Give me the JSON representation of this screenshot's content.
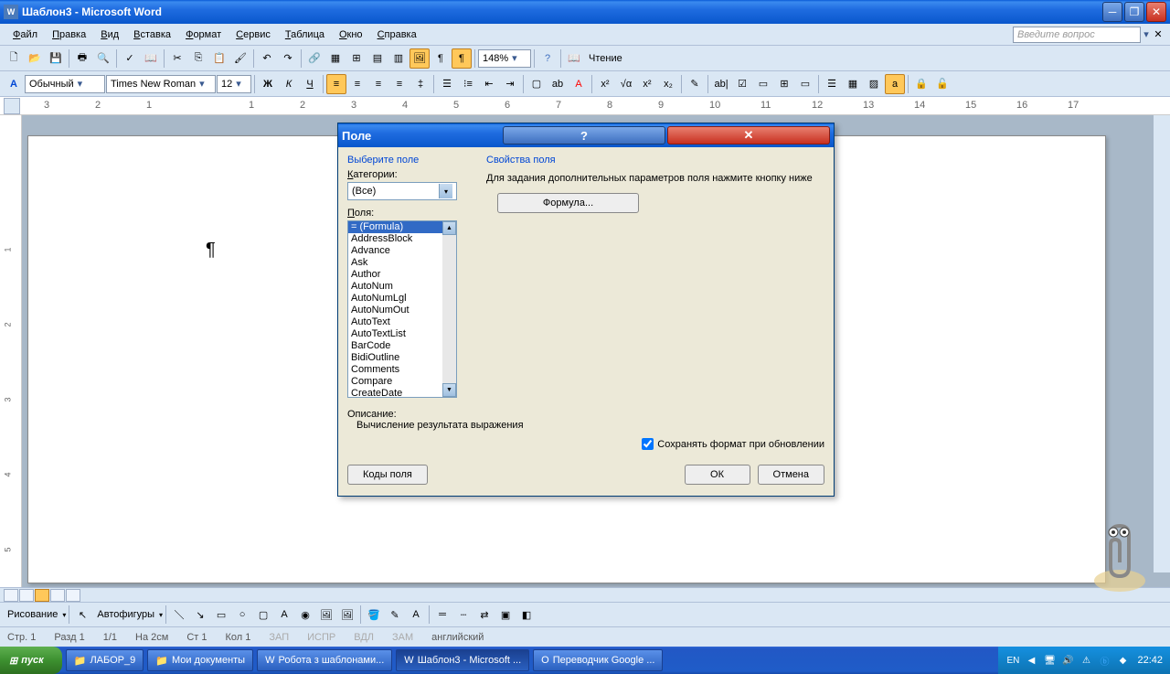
{
  "app": {
    "title": "Шаблон3 - Microsoft Word",
    "icon_letter": "W"
  },
  "menu": {
    "items": [
      "Файл",
      "Правка",
      "Вид",
      "Вставка",
      "Формат",
      "Сервис",
      "Таблица",
      "Окно",
      "Справка"
    ],
    "help_placeholder": "Введите вопрос"
  },
  "toolbar1": {
    "zoom": "148%",
    "reading": "Чтение"
  },
  "format": {
    "style_label": "A",
    "style": "Обычный",
    "font": "Times New Roman",
    "size": "12"
  },
  "ruler": {
    "nums": [
      "3",
      "2",
      "1",
      "",
      "1",
      "2",
      "3",
      "4",
      "5",
      "6",
      "7",
      "8",
      "9",
      "10",
      "11",
      "12",
      "13",
      "14",
      "15",
      "16",
      "17"
    ]
  },
  "vruler": {
    "nums": [
      "",
      "1",
      "2",
      "3",
      "4",
      "5"
    ]
  },
  "drawbar": {
    "draw": "Рисование",
    "autoshapes": "Автофигуры"
  },
  "status": {
    "page": "Стр. 1",
    "sect": "Разд 1",
    "pages": "1/1",
    "at": "На 2см",
    "line": "Ст 1",
    "col": "Кол 1",
    "rec": "ЗАП",
    "trk": "ИСПР",
    "ext": "ВДЛ",
    "ovr": "ЗАМ",
    "lang": "английский"
  },
  "dialog": {
    "title": "Поле",
    "select_field": "Выберите поле",
    "categories_label": "Категории:",
    "category": "(Все)",
    "fields_label": "Поля:",
    "fields": [
      "= (Formula)",
      "AddressBlock",
      "Advance",
      "Ask",
      "Author",
      "AutoNum",
      "AutoNumLgl",
      "AutoNumOut",
      "AutoText",
      "AutoTextList",
      "BarCode",
      "BidiOutline",
      "Comments",
      "Compare",
      "CreateDate"
    ],
    "properties": "Свойства поля",
    "instruction": "Для задания дополнительных параметров поля нажмите кнопку ниже",
    "formula_btn": "Формула...",
    "description_label": "Описание:",
    "description": "Вычисление результата выражения",
    "preserve": "Сохранять формат при обновлении",
    "codes_btn": "Коды поля",
    "ok": "ОК",
    "cancel": "Отмена"
  },
  "taskbar": {
    "start": "пуск",
    "tasks": [
      {
        "label": "ЛАБОР_9",
        "icon": "📁"
      },
      {
        "label": "Мои документы",
        "icon": "📁"
      },
      {
        "label": "Робота з шаблонами...",
        "icon": "W"
      },
      {
        "label": "Шаблон3 - Microsoft ...",
        "icon": "W",
        "active": true
      },
      {
        "label": "Переводчик Google ...",
        "icon": "O"
      }
    ],
    "lang": "EN",
    "time": "22:42"
  }
}
